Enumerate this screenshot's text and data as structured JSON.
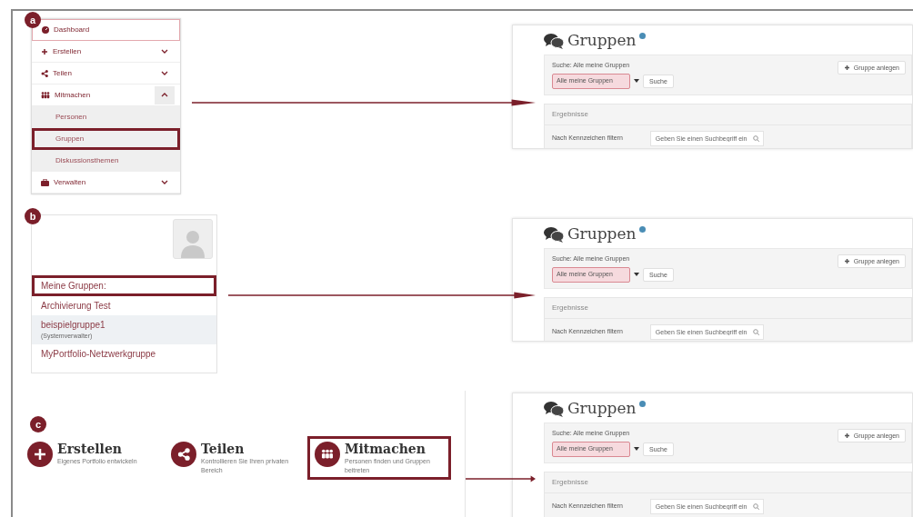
{
  "panels": [
    {
      "label": "a",
      "source": {
        "kind": "menu",
        "items": [
          {
            "label": "Dashboard",
            "selected": true
          },
          {
            "label": "Erstellen",
            "selected": false,
            "expanded": false
          },
          {
            "label": "Teilen",
            "selected": false,
            "expanded": false
          },
          {
            "label": "Mitmachen",
            "selected": false,
            "expanded": true,
            "children": [
              {
                "label": "Personen",
                "highlighted": false
              },
              {
                "label": "Gruppen",
                "highlighted": true
              },
              {
                "label": "Diskussionsthemen",
                "highlighted": false
              }
            ]
          },
          {
            "label": "Verwalten",
            "selected": false,
            "expanded": false
          }
        ]
      },
      "target": {
        "title": "Gruppen",
        "search_label": "Suche: Alle meine Gruppen",
        "select_value": "Alle meine Gruppen",
        "search_button": "Suche",
        "add_button": "Gruppe anlegen",
        "results_heading": "Ergebnisse",
        "filter_label": "Nach Kennzeichen filtern",
        "filter_placeholder": "Geben Sie einen Suchbegriff ein"
      }
    },
    {
      "label": "b",
      "source": {
        "kind": "profile",
        "heading": {
          "label": "Meine Gruppen:",
          "highlighted": true
        },
        "groups": [
          {
            "name": "Archivierung Test",
            "selected": false
          },
          {
            "name": "beispielgruppe1",
            "role": "(Systemverwalter)",
            "selected": true
          },
          {
            "name": "MyPortfolio-Netzwerkgruppe",
            "selected": false
          }
        ]
      },
      "target": {
        "title": "Gruppen",
        "search_label": "Suche: Alle meine Gruppen",
        "select_value": "Alle meine Gruppen",
        "search_button": "Suche",
        "add_button": "Gruppe anlegen",
        "results_heading": "Ergebnisse",
        "filter_label": "Nach Kennzeichen filtern",
        "filter_placeholder": "Geben Sie einen Suchbegriff ein"
      }
    },
    {
      "label": "c",
      "source": {
        "kind": "tiles",
        "tiles": [
          {
            "title": "Erstellen",
            "description": "Eigenes Portfolio entwickeln",
            "highlighted": false
          },
          {
            "title": "Teilen",
            "description": "Kontrollieren Sie Ihren privaten Bereich",
            "highlighted": false
          },
          {
            "title": "Mitmachen",
            "description": "Personen finden und Gruppen beitreten",
            "highlighted": true
          }
        ]
      },
      "target": {
        "title": "Gruppen",
        "search_label": "Suche: Alle meine Gruppen",
        "select_value": "Alle meine Gruppen",
        "search_button": "Suche",
        "add_button": "Gruppe anlegen",
        "results_heading": "Ergebnisse",
        "filter_label": "Nach Kennzeichen filtern",
        "filter_placeholder": "Geben Sie einen Suchbegriff ein"
      }
    }
  ]
}
